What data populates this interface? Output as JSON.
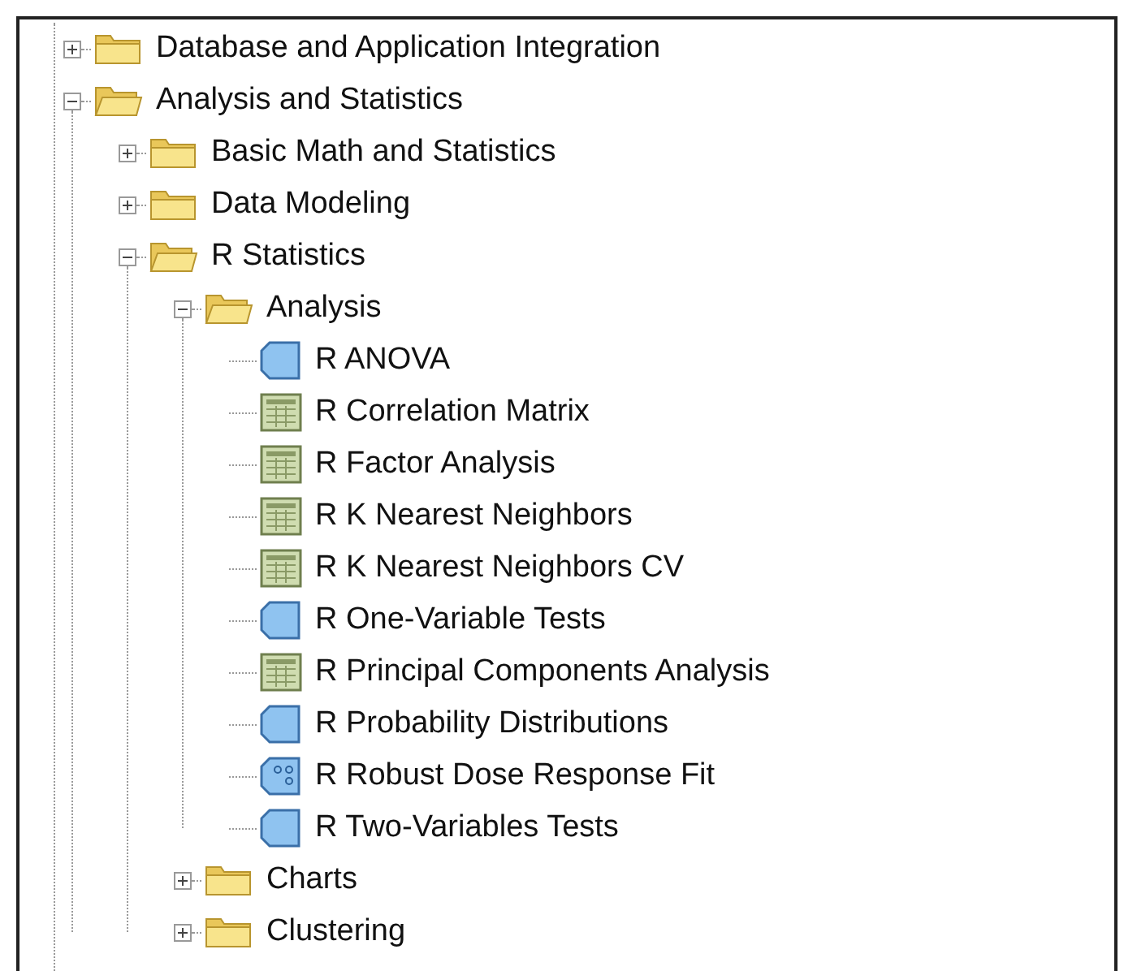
{
  "tree": [
    {
      "label": "Database and Application Integration",
      "kind": "folder",
      "expanded": false
    },
    {
      "label": "Analysis and Statistics",
      "kind": "folder",
      "expanded": true,
      "children": [
        {
          "label": "Basic Math and Statistics",
          "kind": "folder",
          "expanded": false
        },
        {
          "label": "Data Modeling",
          "kind": "folder",
          "expanded": false
        },
        {
          "label": "R Statistics",
          "kind": "folder",
          "expanded": true,
          "children": [
            {
              "label": "Analysis",
              "kind": "folder",
              "expanded": true,
              "children": [
                {
                  "label": "R ANOVA",
                  "kind": "node"
                },
                {
                  "label": "R Correlation Matrix",
                  "kind": "table"
                },
                {
                  "label": "R Factor Analysis",
                  "kind": "table"
                },
                {
                  "label": "R K Nearest Neighbors",
                  "kind": "table"
                },
                {
                  "label": "R K Nearest Neighbors CV",
                  "kind": "table"
                },
                {
                  "label": "R One-Variable Tests",
                  "kind": "node"
                },
                {
                  "label": "R Principal Components Analysis",
                  "kind": "table"
                },
                {
                  "label": "R Probability Distributions",
                  "kind": "node"
                },
                {
                  "label": "R Robust Dose Response Fit",
                  "kind": "scatter"
                },
                {
                  "label": "R Two-Variables Tests",
                  "kind": "node"
                }
              ]
            },
            {
              "label": "Charts",
              "kind": "folder",
              "expanded": false
            },
            {
              "label": "Clustering",
              "kind": "folder",
              "expanded": false
            }
          ]
        }
      ]
    }
  ]
}
